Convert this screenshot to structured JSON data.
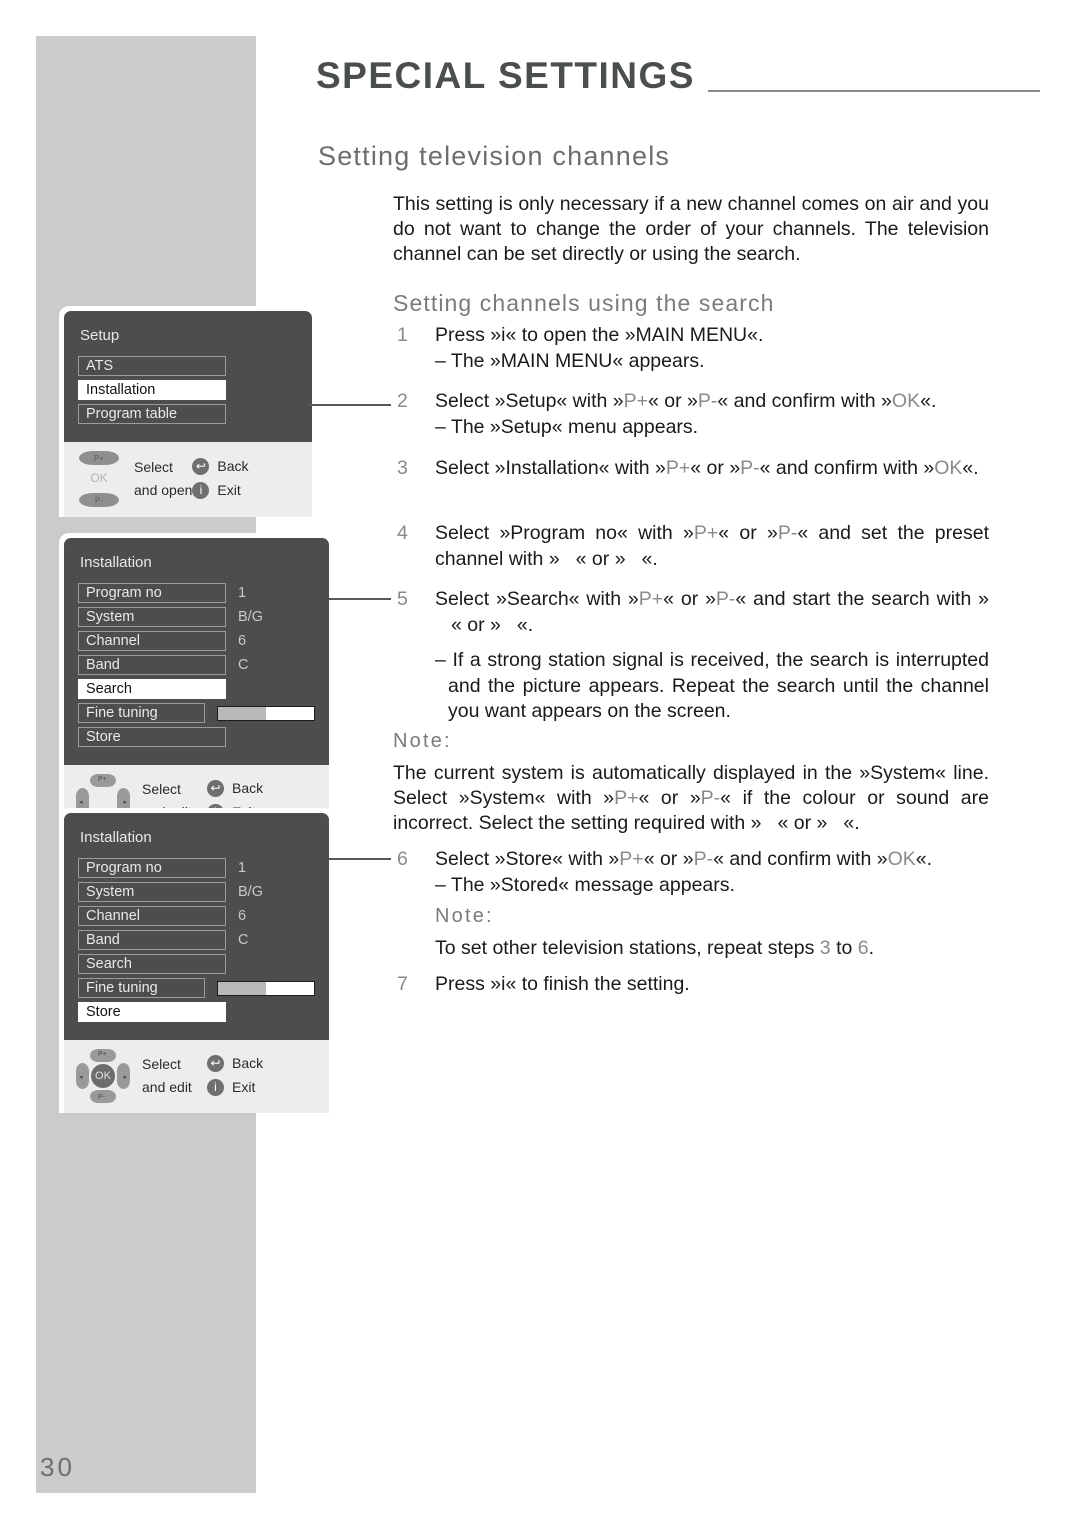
{
  "document": {
    "title": "SPECIAL SETTINGS",
    "page_number": "30",
    "heading": "Setting television channels",
    "intro": "This setting is only necessary if a new channel comes on air and you do not want to change the order of your channels. The television channel can be set directly or using the search.",
    "subheading": "Setting channels using the search"
  },
  "steps": {
    "s1_num": "1",
    "s1_text": "Press »i« to open the »MAIN MENU«.",
    "s1_sub": "– The »MAIN MENU« appears.",
    "s2_num": "2",
    "s2_text_a": "Select »Setup« with »",
    "s2_pplus": "P+",
    "s2_text_b": "« or »",
    "s2_pminus": "P-",
    "s2_text_c": "« and confirm with »",
    "s2_ok": "OK",
    "s2_text_d": "«.",
    "s2_sub": "– The »Setup« menu appears.",
    "s3_num": "3",
    "s3_text_a": "Select »Installation« with »",
    "s3_text_b": "« or »",
    "s3_text_c": "« and confirm with",
    "s3_text_d": "«.",
    "s4_num": "4",
    "s4_text_a": "Select »Program no« with »",
    "s4_text_b": "« or »",
    "s4_text_c": "« and set the preset channel with »",
    "s4_text_d": "« or »",
    "s4_text_e": "«.",
    "s5_num": "5",
    "s5_text_a": "Select »Search« with »",
    "s5_text_b": "« or »",
    "s5_text_c": "« and start the search with »",
    "s5_text_d": "« or »",
    "s5_text_e": "«.",
    "s5_sub": "– If a strong station signal is received, the search is interrupted and the picture appears. Repeat the search until the channel you want appears on the screen.",
    "note1_label": "Note:",
    "note1_text_a": "The current system is automatically displayed in the »System« line. Select »System« with »",
    "note1_text_b": "« or »",
    "note1_text_c": "« if the colour or sound are incorrect. Select the setting required with »",
    "note1_text_d": "« or »",
    "note1_text_e": "«.",
    "s6_num": "6",
    "s6_text_a": "Select »Store« with »",
    "s6_text_b": "« or »",
    "s6_text_c": "« and confirm with »",
    "s6_text_d": "«.",
    "s6_sub": "– The »Stored« message appears.",
    "note2_label": "Note:",
    "note2_text_a": "To set other television stations, repeat steps ",
    "note2_from": "3",
    "note2_mid": " to ",
    "note2_to": "6",
    "note2_end": ".",
    "s7_num": "7",
    "s7_text": "Press »i« to finish the setting."
  },
  "osd_setup": {
    "title": "Setup",
    "items": [
      {
        "label": "ATS",
        "selected": false,
        "value": ""
      },
      {
        "label": "Installation",
        "selected": true,
        "value": ""
      },
      {
        "label": "Program table",
        "selected": false,
        "value": ""
      }
    ],
    "footer": {
      "line1": "Select",
      "line2": "and open",
      "back": "Back",
      "exit": "Exit",
      "ok_label": "OK",
      "p_plus": "P+",
      "p_minus": "P-",
      "back_glyph": "↩",
      "exit_glyph": "i"
    }
  },
  "osd_installation_search": {
    "title": "Installation",
    "items": [
      {
        "label": "Program no",
        "selected": false,
        "value": "1",
        "bar": null
      },
      {
        "label": "System",
        "selected": false,
        "value": "B/G",
        "bar": null
      },
      {
        "label": "Channel",
        "selected": false,
        "value": "6",
        "bar": null
      },
      {
        "label": "Band",
        "selected": false,
        "value": "C",
        "bar": null
      },
      {
        "label": "Search",
        "selected": true,
        "value": "",
        "bar": null
      },
      {
        "label": "Fine tuning",
        "selected": false,
        "value": "",
        "bar": 50
      },
      {
        "label": "Store",
        "selected": false,
        "value": "",
        "bar": null
      }
    ],
    "footer": {
      "line1": "Select",
      "line2": "and edit",
      "back": "Back",
      "exit": "Exit",
      "ok_label": "",
      "p_plus": "P+",
      "p_minus": "P-",
      "back_glyph": "↩",
      "exit_glyph": "i"
    }
  },
  "osd_installation_store": {
    "title": "Installation",
    "items": [
      {
        "label": "Program no",
        "selected": false,
        "value": "1",
        "bar": null
      },
      {
        "label": "System",
        "selected": false,
        "value": "B/G",
        "bar": null
      },
      {
        "label": "Channel",
        "selected": false,
        "value": "6",
        "bar": null
      },
      {
        "label": "Band",
        "selected": false,
        "value": "C",
        "bar": null
      },
      {
        "label": "Search",
        "selected": false,
        "value": "",
        "bar": null
      },
      {
        "label": "Fine tuning",
        "selected": false,
        "value": "",
        "bar": 50
      },
      {
        "label": "Store",
        "selected": true,
        "value": "",
        "bar": null
      }
    ],
    "footer": {
      "line1": "Select",
      "line2": "and edit",
      "back": "Back",
      "exit": "Exit",
      "ok_label": "OK",
      "p_plus": "P+",
      "p_minus": "P-",
      "back_glyph": "↩",
      "exit_glyph": "i"
    }
  },
  "colors": {
    "sidebar": "#cbcbcb",
    "osd_bg": "#4d4d4d",
    "osd_footer": "#ededed",
    "heading_grey": "#6d6d6d",
    "accent_grey": "#8a8a8a"
  }
}
